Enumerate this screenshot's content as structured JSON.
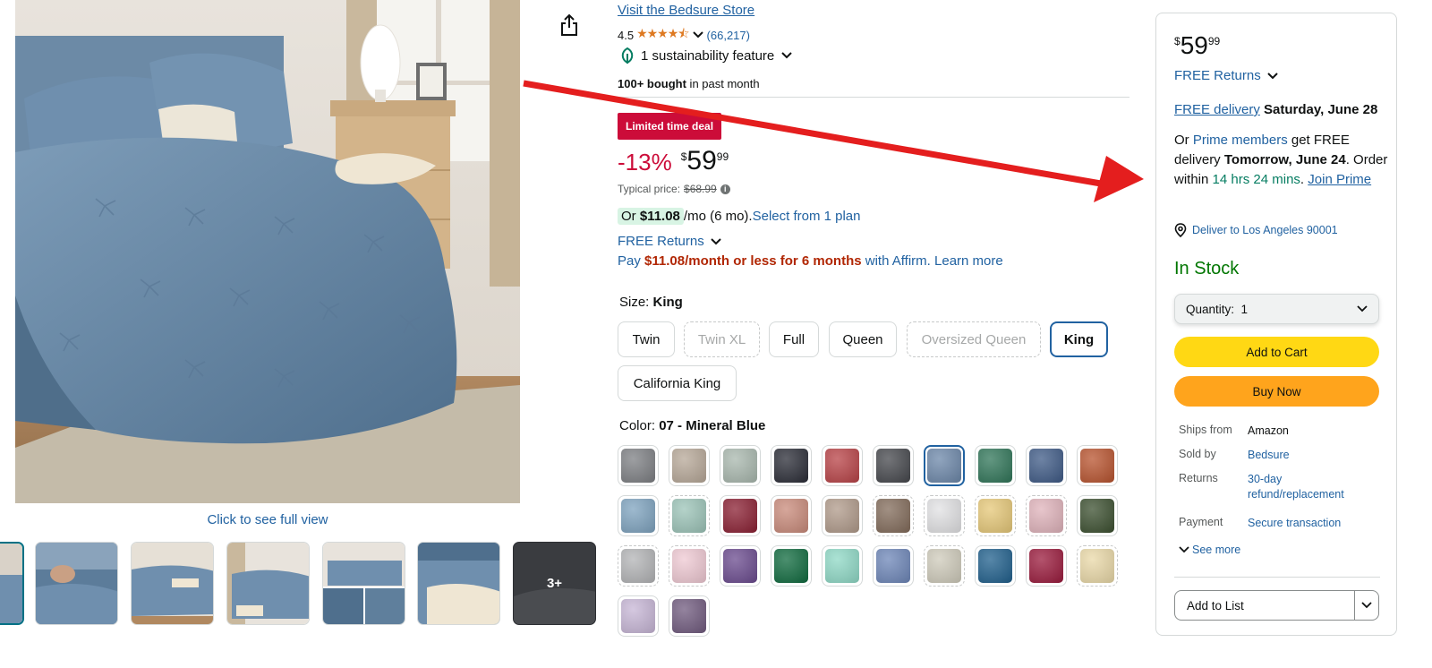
{
  "gallery": {
    "full_view_link": "Click to see full view",
    "more_label": "3+"
  },
  "product": {
    "store_link": "Visit the Bedsure Store",
    "rating": "4.5",
    "stars": "★★★★⯪",
    "rating_count": "(66,217)",
    "sustainability": "1 sustainability feature",
    "bought_bold": "100+ bought",
    "bought_rest": " in past month",
    "deal_badge": "Limited time deal",
    "discount": "-13%",
    "currency": "$",
    "price_whole": "59",
    "price_cents": "99",
    "typical_label": "Typical price:",
    "typical_price": "$68.99",
    "monthly_or": "Or ",
    "monthly_amount": "$11.08",
    "monthly_rest": " /mo (6 mo). ",
    "monthly_plan_link": "Select from 1 plan",
    "free_returns": "FREE Returns",
    "affirm_pay": "Pay ",
    "affirm_amount": "$11.08/month or less for 6 months",
    "affirm_with": " with Affirm. ",
    "affirm_learn": "Learn more"
  },
  "size": {
    "label": "Size: ",
    "selected": "King",
    "options": [
      "Twin",
      "Twin XL",
      "Full",
      "Queen",
      "Oversized Queen",
      "King",
      "California King"
    ]
  },
  "color": {
    "label": "Color: ",
    "selected": "07 - Mineral Blue",
    "swatches": [
      "#7d7f83",
      "#b7a898",
      "#a9b8ae",
      "#2a2c36",
      "#b84246",
      "#45474c",
      "#6c87a9",
      "#2f7558",
      "#3e5a86",
      "#b8532e",
      "#7ea3bf",
      "#9cc4b8",
      "#8a1f32",
      "#c98a7a",
      "#b09a8a",
      "#826b5a",
      "#e2e2e4",
      "#e6c878",
      "#e0b3bb",
      "#3b4f2f",
      "#b3b4b6",
      "#efc9d3",
      "#6a4a8e",
      "#0f6a3e",
      "#8fd9c6",
      "#6d86b8",
      "#cfcbbb",
      "#1f5f8c",
      "#9a1a3c",
      "#ead9a8",
      "#c7b6d6",
      "#705a7e"
    ]
  },
  "buybox": {
    "currency": "$",
    "price_whole": "59",
    "price_cents": "99",
    "free_returns": "FREE Returns",
    "free_delivery": "FREE delivery",
    "delivery_date": " Saturday, June 28",
    "prime_or": "Or ",
    "prime_members": "Prime members",
    "prime_get": " get FREE delivery ",
    "prime_date": "Tomorrow, June 24",
    "prime_order": ". Order within ",
    "prime_countdown": "14 hrs 24 mins",
    "prime_period": ". ",
    "join_prime": "Join Prime",
    "location": "Deliver to Los Angeles 90001",
    "stock": "In Stock",
    "quantity_label": "Quantity:",
    "quantity_value": "1",
    "add_to_cart": "Add to Cart",
    "buy_now": "Buy Now",
    "details": [
      {
        "key": "Ships from",
        "value": "Amazon"
      },
      {
        "key": "Sold by",
        "value": "Bedsure"
      },
      {
        "key": "Returns",
        "value": "30-day refund/replacement"
      },
      {
        "key": "Payment",
        "value": "Secure transaction"
      }
    ],
    "see_more": "See more",
    "add_to_list": "Add to List"
  }
}
